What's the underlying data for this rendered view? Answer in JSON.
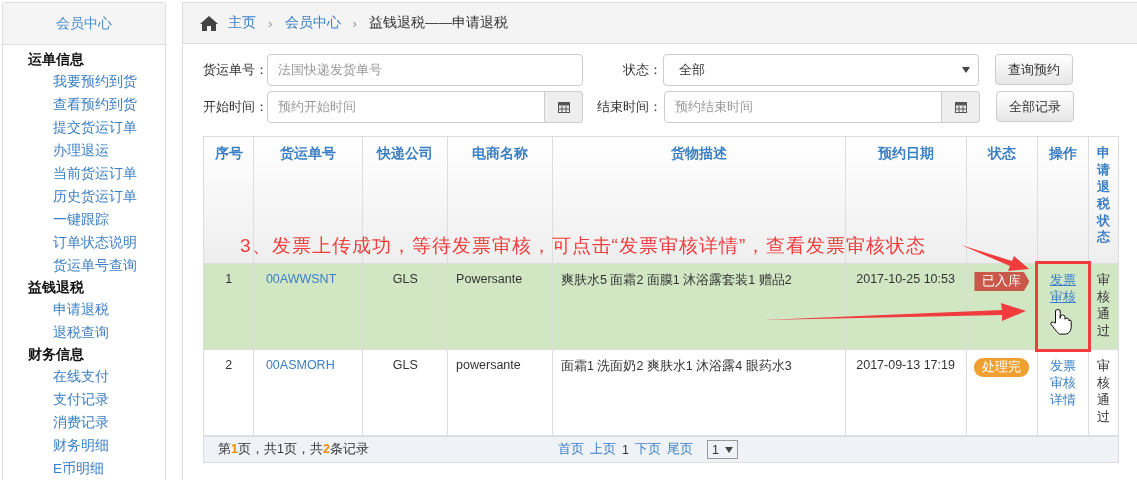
{
  "sidebar": {
    "title": "会员中心",
    "groups": [
      {
        "label": "运单信息",
        "items": [
          {
            "label": "我要预约到货",
            "selected": false
          },
          {
            "label": "查看预约到货",
            "selected": false
          },
          {
            "label": "提交货运订单",
            "selected": false
          },
          {
            "label": "办理退运",
            "selected": false
          },
          {
            "label": "当前货运订单",
            "selected": false
          },
          {
            "label": "历史货运订单",
            "selected": false
          },
          {
            "label": "一键跟踪",
            "selected": false
          },
          {
            "label": "订单状态说明",
            "selected": false
          },
          {
            "label": "货运单号查询",
            "selected": false
          }
        ]
      },
      {
        "label": "益钱退税",
        "items": [
          {
            "label": "申请退税",
            "selected": false
          },
          {
            "label": "退税查询",
            "selected": false
          }
        ]
      },
      {
        "label": "财务信息",
        "items": [
          {
            "label": "在线支付",
            "selected": false
          },
          {
            "label": "支付记录",
            "selected": false
          },
          {
            "label": "消费记录",
            "selected": false
          },
          {
            "label": "财务明细",
            "selected": false
          },
          {
            "label": "E币明细",
            "selected": false
          }
        ]
      }
    ]
  },
  "breadcrumb": [
    {
      "label": "主页",
      "link": true
    },
    {
      "label": "会员中心",
      "link": true,
      "separator": "›"
    },
    {
      "label": "益钱退税——申请退税",
      "link": false,
      "separator": "›"
    }
  ],
  "filters": {
    "tracking": {
      "label": "货运单号：",
      "placeholder": "法国快递发货单号"
    },
    "status": {
      "label": "状态：",
      "value": "全部"
    },
    "start": {
      "label": "开始时间：",
      "placeholder": "预约开始时间"
    },
    "end": {
      "label": "结束时间：",
      "placeholder": "预约结束时间"
    },
    "buttons": [
      "查询预约",
      "全部记录"
    ]
  },
  "table": {
    "columns": [
      "序号",
      "货运单号",
      "快递公司",
      "电商名称",
      "货物描述",
      "预约日期",
      "状态",
      "操作",
      "申请退税状态"
    ],
    "rows": [
      {
        "no": "1",
        "tracking": "00AWWSNT",
        "courier": "GLS",
        "shop": "Powersante",
        "goods": "爽肤水5 面霜2 面膜1 沐浴露套装1 赠品2",
        "date": "2017-10-25 10:53",
        "status": {
          "label": "已入库",
          "color": "#c9574a"
        },
        "action": "发票审核",
        "refund": "审核通过",
        "highlighted": true
      },
      {
        "no": "2",
        "tracking": "00ASMORH",
        "courier": "GLS",
        "shop": "powersante",
        "goods": "面霜1 洗面奶2 爽肤水1 沐浴露4 眼药水3",
        "date": "2017-09-13 17:19",
        "status": {
          "label": "处理完",
          "color": "#f0a030"
        },
        "action": "发票审核详情",
        "refund": "审核通过",
        "highlighted": false
      }
    ],
    "summary": "第**1**页，共1页，共**2**条记录",
    "pager": [
      "首页",
      "上页",
      "1",
      "下页",
      "尾页"
    ],
    "page_select": "1"
  },
  "annotation": {
    "text": "3、发票上传成功，等待发票审核，可点击“发票审核详情”，查看发票审核状态"
  }
}
